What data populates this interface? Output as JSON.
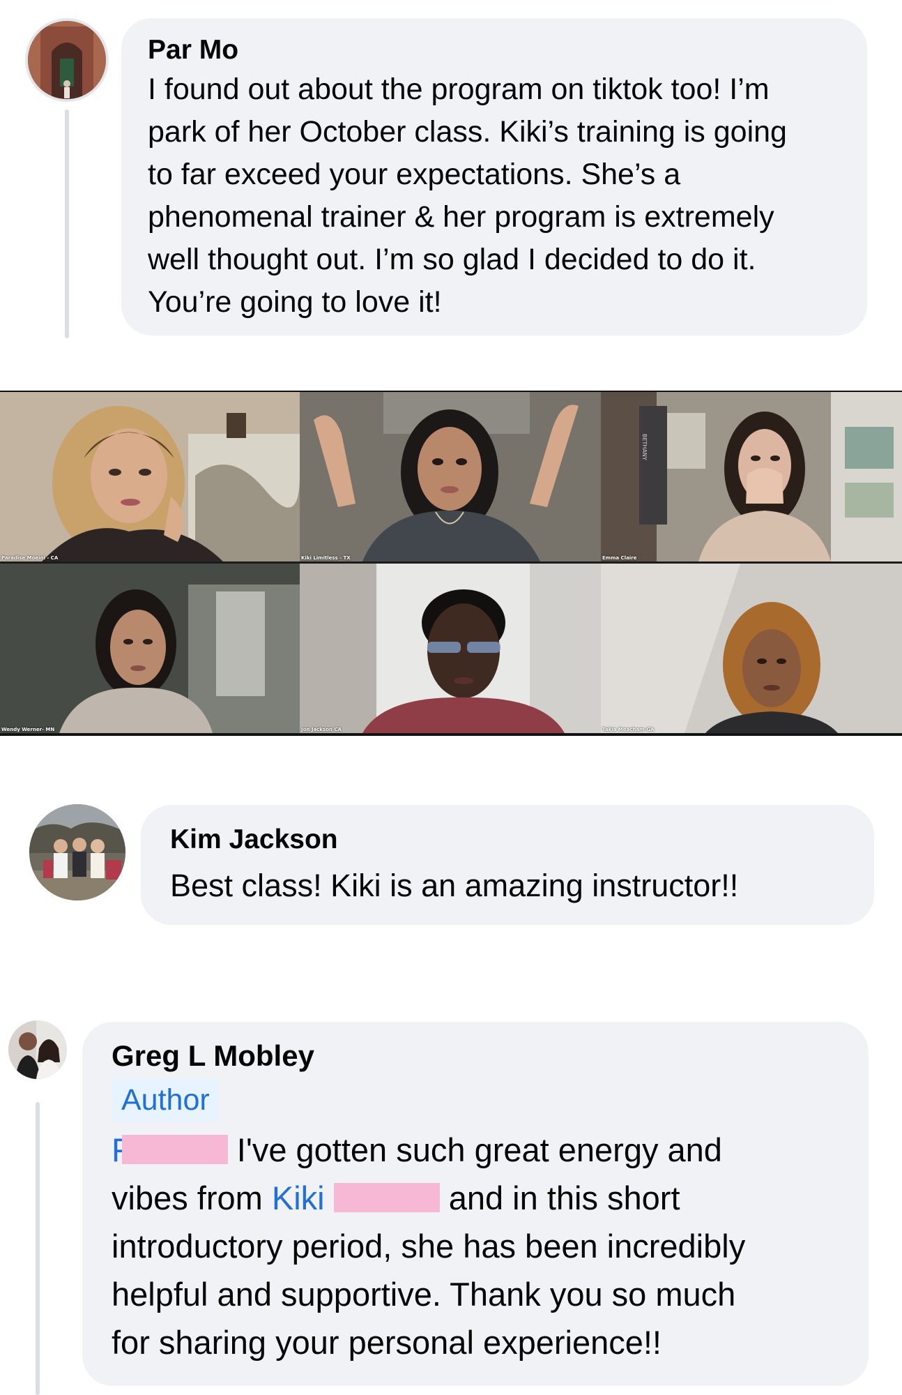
{
  "comments": [
    {
      "author": "Par Mo",
      "lines": [
        "I found out about the program on tiktok too! I’m",
        "park of her October class. Kiki’s training is going",
        "to far exceed your expectations. She’s a",
        "phenomenal trainer & her program is extremely",
        "well thought out. I’m so glad I decided to do it.",
        "You’re going to love it!"
      ]
    },
    {
      "author": "Kim Jackson",
      "text": "Best class! Kiki is an amazing instructor!!"
    },
    {
      "author": "Greg L Mobley",
      "badge": "Author",
      "line1_after_redaction": "I've gotten such great energy and",
      "line2_prefix": "vibes from ",
      "line2_mention": "Kiki",
      "line2_after_redaction": "and in this short",
      "lines_rest": [
        "introductory period, she has been incredibly",
        "helpful and supportive. Thank you so much",
        "for sharing your personal experience!!"
      ]
    }
  ],
  "video_call": {
    "participants": [
      "Paradise Moeini - CA",
      "Kiki Limitless - TX",
      "Emma Claire",
      "Wendy Werner- MN",
      "Jon Jackson CA",
      "Takia Meacham-GA"
    ],
    "wall_banner_text": "BETHANY"
  },
  "colors": {
    "bubble": "#f0f2f5",
    "mention_link": "#216fdb",
    "author_badge_bg": "#e7f3ff",
    "redaction": "#f7b8d5",
    "thread_line": "#dadde1"
  }
}
